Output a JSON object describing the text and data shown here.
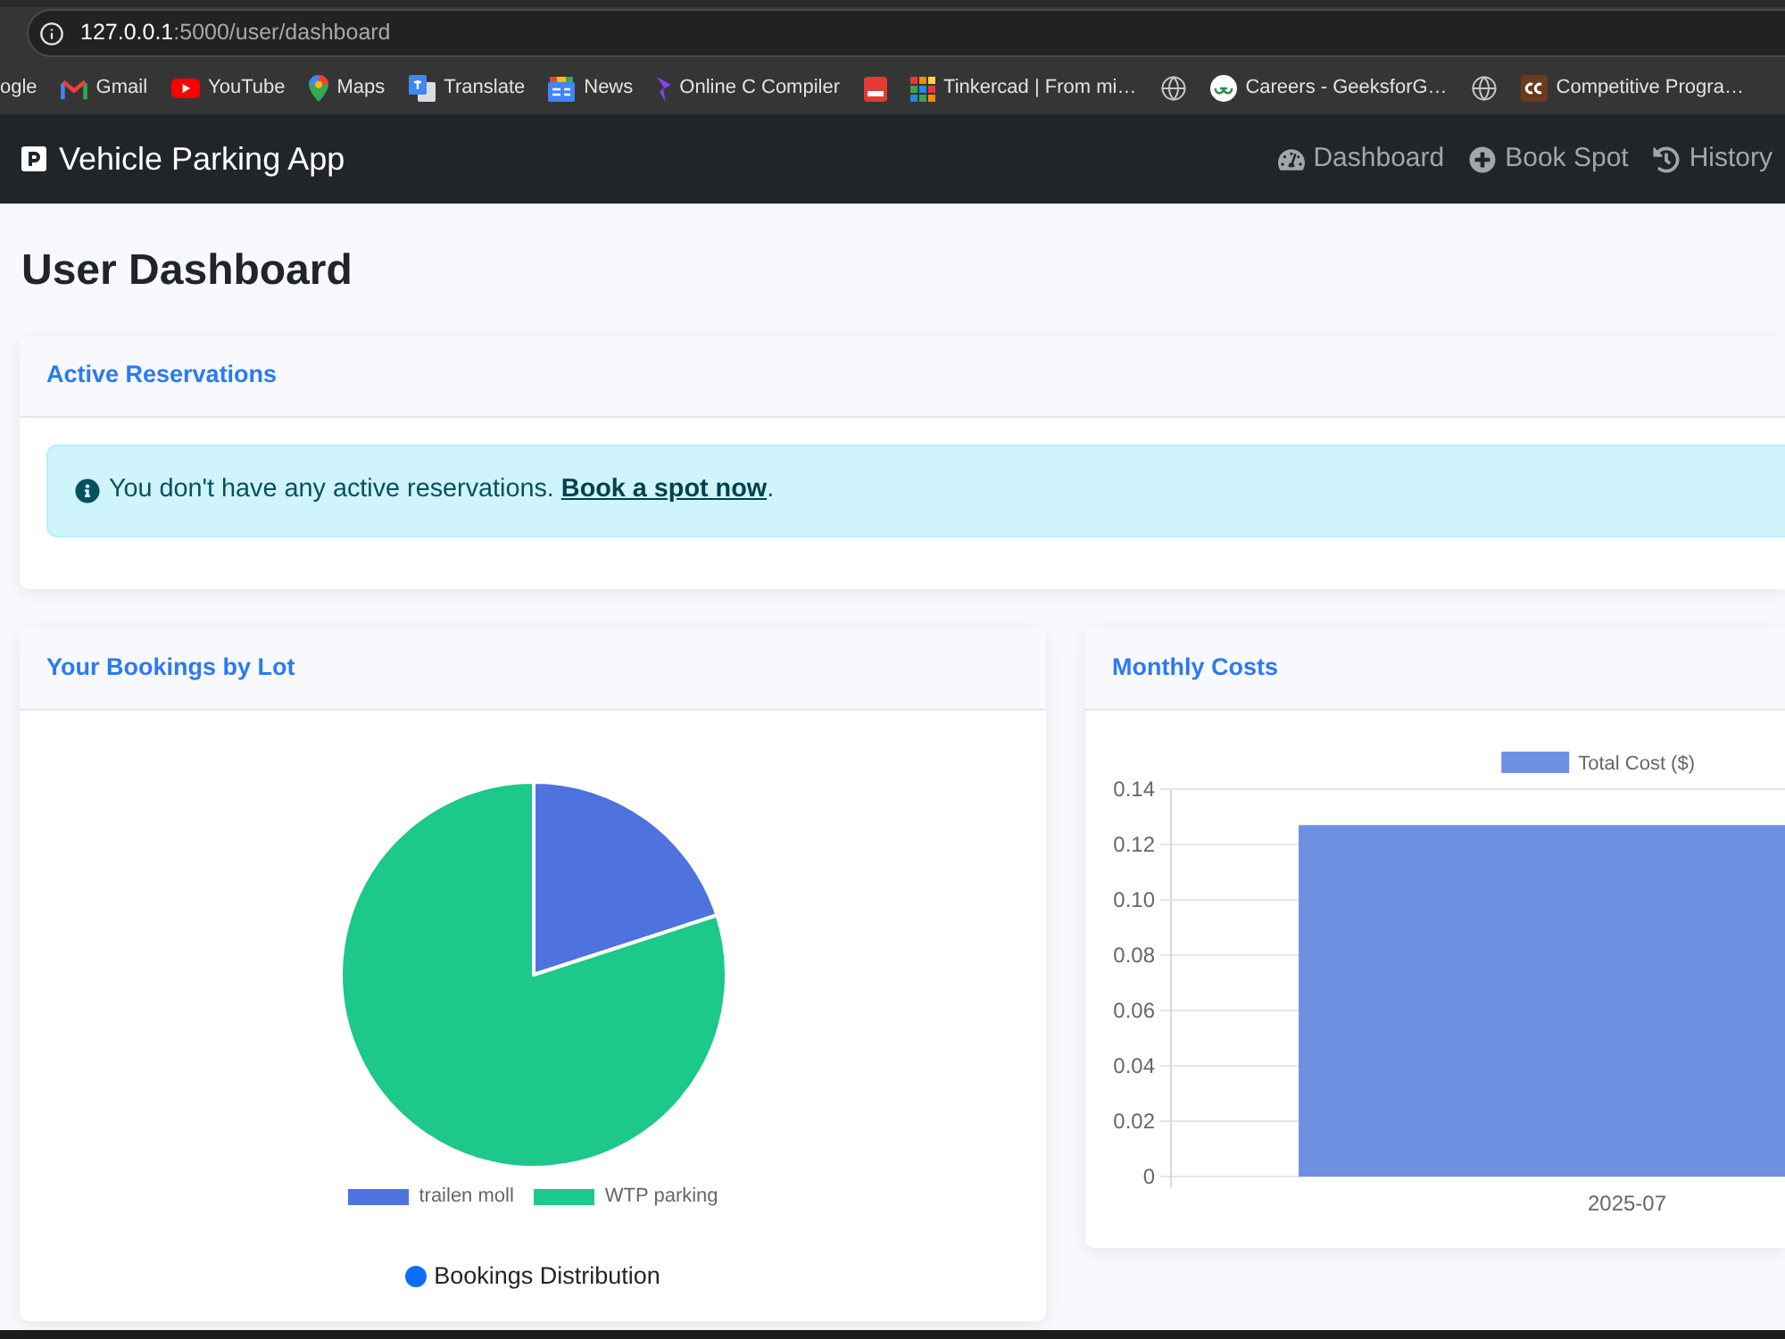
{
  "browser": {
    "address_bar": {
      "host": "127.0.0.1",
      "path": ":5000/user/dashboard"
    },
    "bookmarks": [
      {
        "kind": "text",
        "label": "ogle"
      },
      {
        "kind": "link",
        "label": "Gmail"
      },
      {
        "kind": "link",
        "label": "YouTube"
      },
      {
        "kind": "link",
        "label": "Maps"
      },
      {
        "kind": "link",
        "label": "Translate"
      },
      {
        "kind": "link",
        "label": "News"
      },
      {
        "kind": "link",
        "label": "Online C Compiler"
      },
      {
        "kind": "icon"
      },
      {
        "kind": "link",
        "label": "Tinkercad | From mi…"
      },
      {
        "kind": "icon"
      },
      {
        "kind": "link",
        "label": "Careers - GeeksforG…"
      },
      {
        "kind": "icon"
      },
      {
        "kind": "link",
        "label": "Competitive Progra…"
      }
    ]
  },
  "navbar": {
    "brand": "Vehicle Parking App",
    "links": [
      {
        "label": "Dashboard"
      },
      {
        "label": "Book Spot"
      },
      {
        "label": "History"
      }
    ]
  },
  "page_title": "User Dashboard",
  "active_reservations": {
    "title": "Active Reservations",
    "alert": {
      "text": "You don't have any active reservations.",
      "link": "Book a spot now",
      "suffix": "."
    }
  },
  "bookings_by_lot": {
    "title": "Your Bookings by Lot",
    "legend": [
      {
        "label": "trailen moll",
        "color": "#4e73df"
      },
      {
        "label": "WTP parking",
        "color": "#1cc88a"
      }
    ],
    "caption": "Bookings Distribution"
  },
  "monthly_costs": {
    "title": "Monthly Costs",
    "chart_data": {
      "type": "bar",
      "categories": [
        "2025-07"
      ],
      "series": [
        {
          "name": "Total Cost ($)",
          "color": "#6f8fe3",
          "values": [
            0.127
          ]
        }
      ],
      "ylim": [
        0,
        0.14
      ],
      "yticks": [
        0,
        0.02,
        0.04,
        0.06,
        0.08,
        {
          "value": 0.1,
          "label": "0.10"
        },
        0.12,
        0.14
      ],
      "grid": true
    }
  }
}
